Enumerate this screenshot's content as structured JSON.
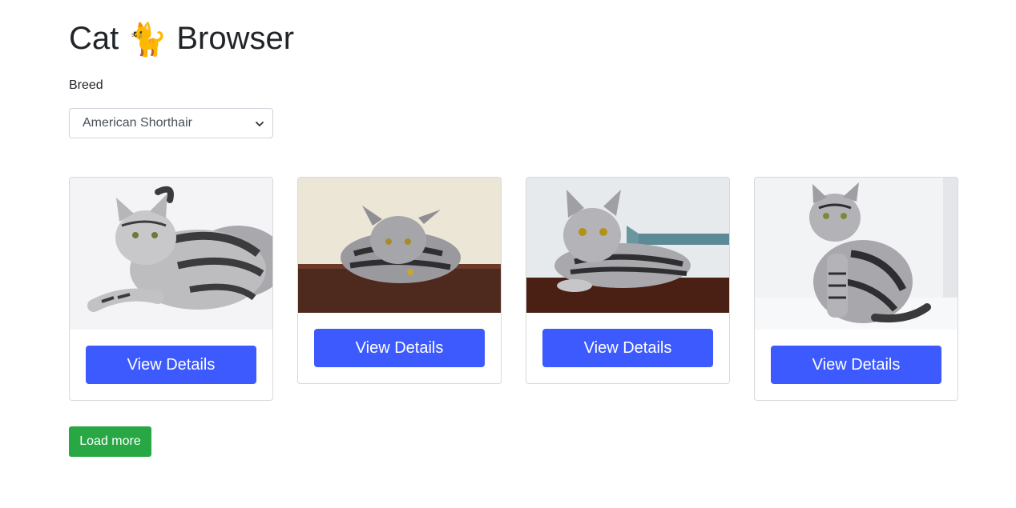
{
  "header": {
    "title_prefix": "Cat",
    "title_emoji": "🐈",
    "title_suffix": "Browser"
  },
  "filter": {
    "label": "Breed",
    "selected": "American Shorthair"
  },
  "cards": [
    {
      "button_label": "View Details",
      "photo": "cat-lying-white-background"
    },
    {
      "button_label": "View Details",
      "photo": "cat-loafing-on-wood-table"
    },
    {
      "button_label": "View Details",
      "photo": "cat-lying-by-teal-wall"
    },
    {
      "button_label": "View Details",
      "photo": "cat-sitting-white-background"
    }
  ],
  "actions": {
    "load_more_label": "Load more"
  },
  "colors": {
    "primary_button": "#3d5afe",
    "success_button": "#28a745",
    "text": "#212529"
  }
}
